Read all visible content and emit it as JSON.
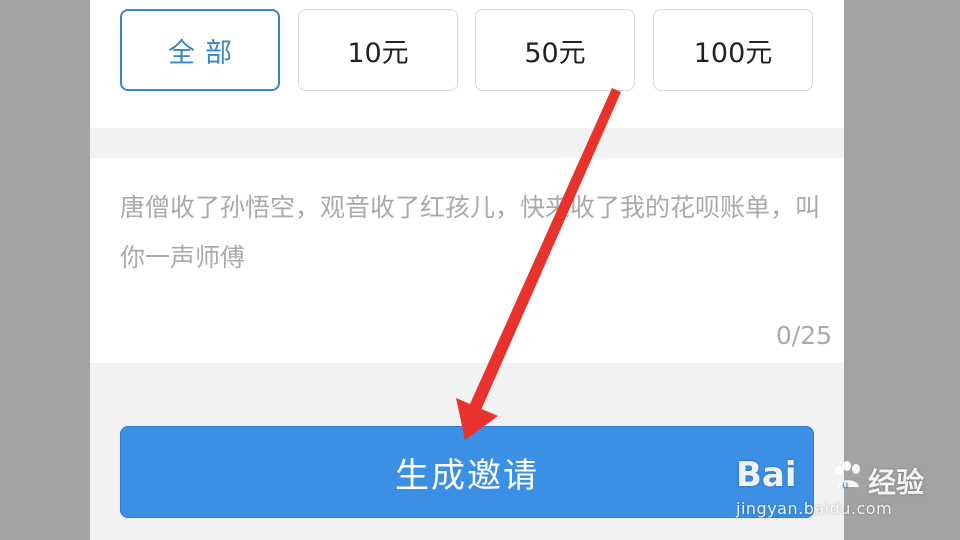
{
  "amounts": {
    "options": [
      {
        "label": "全部",
        "selected": true
      },
      {
        "label": "10元",
        "selected": false
      },
      {
        "label": "50元",
        "selected": false
      },
      {
        "label": "100元",
        "selected": false
      }
    ]
  },
  "message": {
    "placeholder": "唐僧收了孙悟空，观音收了红孩儿，快来收了我的花呗账单，叫你一声师傅",
    "count": "0/25"
  },
  "actions": {
    "generate_label": "生成邀请"
  },
  "watermark": {
    "logo_left": "Bai",
    "logo_right": "u",
    "title": "经验",
    "url": "jingyan.baidu.com"
  },
  "colors": {
    "accent": "#3b8fe5",
    "selected_border": "#3a86c4",
    "annotation_arrow": "#e8322c"
  }
}
